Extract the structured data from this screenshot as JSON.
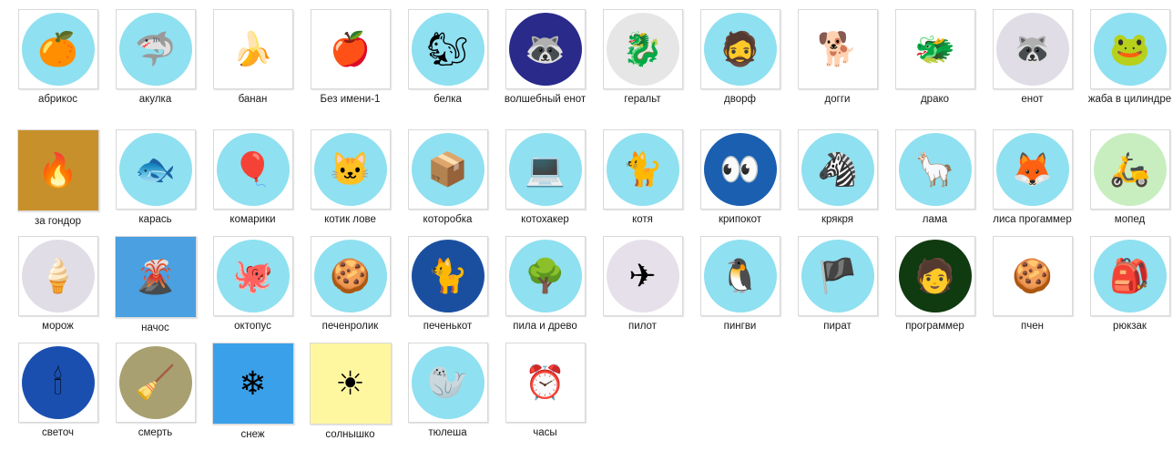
{
  "items": [
    {
      "label": "абрикос",
      "icon": "apricot-icon",
      "bg": "#8fe0f0",
      "glyph": "🍊",
      "shape": "circle"
    },
    {
      "label": "акулка",
      "icon": "shark-icon",
      "bg": "#8fe0f0",
      "glyph": "🦈",
      "shape": "circle"
    },
    {
      "label": "банан",
      "icon": "banana-icon",
      "bg": "#ffffff",
      "glyph": "🍌",
      "shape": "plain"
    },
    {
      "label": "Без имени-1",
      "icon": "apple-icon",
      "bg": "#ffffff",
      "glyph": "🍎",
      "shape": "plain"
    },
    {
      "label": "белка",
      "icon": "squirrel-icon",
      "bg": "#8fe0f0",
      "glyph": "🐿",
      "shape": "circle"
    },
    {
      "label": "волшебный енот",
      "icon": "wizard-raccoon-icon",
      "bg": "#2a2a8a",
      "glyph": "🦝",
      "shape": "circle"
    },
    {
      "label": "геральт",
      "icon": "geralt-icon",
      "bg": "#e6e6e6",
      "glyph": "🐉",
      "shape": "circle"
    },
    {
      "label": "дворф",
      "icon": "dwarf-icon",
      "bg": "#8fe0f0",
      "glyph": "🧔",
      "shape": "circle"
    },
    {
      "label": "догги",
      "icon": "doge-icon",
      "bg": "#ffffff",
      "glyph": "🐕",
      "shape": "plain"
    },
    {
      "label": "драко",
      "icon": "dragon-icon",
      "bg": "#ffffff",
      "glyph": "🐲",
      "shape": "plain"
    },
    {
      "label": "енот",
      "icon": "raccoon-icon",
      "bg": "#e0dde6",
      "glyph": "🦝",
      "shape": "circle"
    },
    {
      "label": "жаба в цилиндре",
      "icon": "frog-in-tophat-icon",
      "bg": "#8fe0f0",
      "glyph": "🐸",
      "shape": "circle"
    },
    {
      "label": "за гондор",
      "icon": "for-gondor-icon",
      "bg": "#c8902a",
      "glyph": "🔥",
      "shape": "square"
    },
    {
      "label": "карась",
      "icon": "crucian-icon",
      "bg": "#8fe0f0",
      "glyph": "🐟",
      "shape": "circle"
    },
    {
      "label": "комарики",
      "icon": "balloon-icon",
      "bg": "#8fe0f0",
      "glyph": "🎈",
      "shape": "circle"
    },
    {
      "label": "котик лове",
      "icon": "cat-love-icon",
      "bg": "#8fe0f0",
      "glyph": "🐱",
      "shape": "circle"
    },
    {
      "label": "которобка",
      "icon": "cat-box-icon",
      "bg": "#8fe0f0",
      "glyph": "📦",
      "shape": "circle"
    },
    {
      "label": "котохакер",
      "icon": "hacker-cat-icon",
      "bg": "#8fe0f0",
      "glyph": "💻",
      "shape": "circle"
    },
    {
      "label": "котя",
      "icon": "kitty-icon",
      "bg": "#8fe0f0",
      "glyph": "🐈",
      "shape": "circle"
    },
    {
      "label": "крипокот",
      "icon": "creepy-cat-icon",
      "bg": "#1a5fb0",
      "glyph": "👀",
      "shape": "circle"
    },
    {
      "label": "крякря",
      "icon": "duck-zebra-icon",
      "bg": "#8fe0f0",
      "glyph": "🦓",
      "shape": "circle"
    },
    {
      "label": "лама",
      "icon": "llama-icon",
      "bg": "#8fe0f0",
      "glyph": "🦙",
      "shape": "circle"
    },
    {
      "label": "лиса прогаммер",
      "icon": "fox-programmer-icon",
      "bg": "#8fe0f0",
      "glyph": "🦊",
      "shape": "circle"
    },
    {
      "label": "мопед",
      "icon": "moped-icon",
      "bg": "#c8eec0",
      "glyph": "🛵",
      "shape": "circle"
    },
    {
      "label": "морож",
      "icon": "ice-cream-icon",
      "bg": "#e0dde6",
      "glyph": "🍦",
      "shape": "circle"
    },
    {
      "label": "начос",
      "icon": "nachos-icon",
      "bg": "#4aa0e0",
      "glyph": "🌋",
      "shape": "square"
    },
    {
      "label": "октопус",
      "icon": "octopus-icon",
      "bg": "#8fe0f0",
      "glyph": "🐙",
      "shape": "circle"
    },
    {
      "label": "печенролик",
      "icon": "cookie-roller-icon",
      "bg": "#8fe0f0",
      "glyph": "🍪",
      "shape": "circle"
    },
    {
      "label": "печенькот",
      "icon": "cookie-cat-icon",
      "bg": "#1a4fa0",
      "glyph": "🐈",
      "shape": "circle"
    },
    {
      "label": "пила и древо",
      "icon": "saw-and-tree-icon",
      "bg": "#8fe0f0",
      "glyph": "🌳",
      "shape": "circle"
    },
    {
      "label": "пилот",
      "icon": "pilot-icon",
      "bg": "#e6e0ea",
      "glyph": "✈",
      "shape": "circle"
    },
    {
      "label": "пингви",
      "icon": "penguin-icon",
      "bg": "#8fe0f0",
      "glyph": "🐧",
      "shape": "circle"
    },
    {
      "label": "пират",
      "icon": "pirate-icon",
      "bg": "#8fe0f0",
      "glyph": "🏴",
      "shape": "circle"
    },
    {
      "label": "программер",
      "icon": "programmer-icon",
      "bg": "#103a10",
      "glyph": "🧑",
      "shape": "circle"
    },
    {
      "label": "пчен",
      "icon": "cookie-spear-icon",
      "bg": "#ffffff",
      "glyph": "🍪",
      "shape": "plain"
    },
    {
      "label": "рюкзак",
      "icon": "backpack-icon",
      "bg": "#8fe0f0",
      "glyph": "🎒",
      "shape": "circle"
    },
    {
      "label": "светоч",
      "icon": "candle-icon",
      "bg": "#1a4fb0",
      "glyph": "🕯",
      "shape": "circle"
    },
    {
      "label": "смерть",
      "icon": "death-icon",
      "bg": "#a8a070",
      "glyph": "🧹",
      "shape": "circle"
    },
    {
      "label": "снеж",
      "icon": "snowflake-icon",
      "bg": "#3aa0ea",
      "glyph": "❄",
      "shape": "square"
    },
    {
      "label": "солнышко",
      "icon": "angry-sun-icon",
      "bg": "#fff7a0",
      "glyph": "☀",
      "shape": "square"
    },
    {
      "label": "тюлеша",
      "icon": "seal-icon",
      "bg": "#8fe0f0",
      "glyph": "🦭",
      "shape": "circle"
    },
    {
      "label": "часы",
      "icon": "alarm-clock-icon",
      "bg": "#ffffff",
      "glyph": "⏰",
      "shape": "plain"
    }
  ]
}
